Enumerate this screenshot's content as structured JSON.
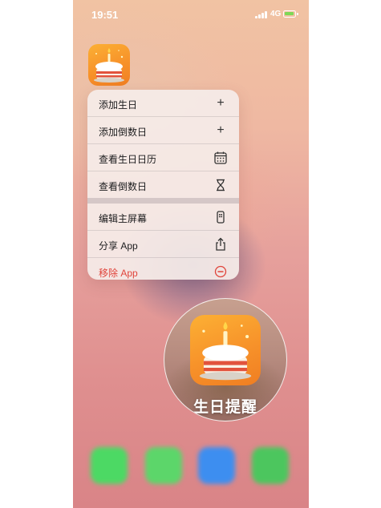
{
  "status_bar": {
    "time": "19:51",
    "network": "4G",
    "battery_charging": true,
    "colors": {
      "battery_fill": "#7ed957"
    }
  },
  "app": {
    "name": "生日提醒",
    "icon": "birthday-cake-icon",
    "colors": {
      "icon_top": "#fcb034",
      "icon_bottom": "#f07e22"
    }
  },
  "context_menu": {
    "items": [
      {
        "label": "添加生日",
        "icon": "plus-icon"
      },
      {
        "label": "添加倒数日",
        "icon": "plus-icon"
      },
      {
        "label": "查看生日日历",
        "icon": "calendar-icon"
      },
      {
        "label": "查看倒数日",
        "icon": "hourglass-icon"
      },
      {
        "label": "编辑主屏幕",
        "icon": "phone-screen-icon"
      },
      {
        "label": "分享 App",
        "icon": "share-icon"
      },
      {
        "label": "移除 App",
        "icon": "minus-circle-icon",
        "destructive": true,
        "color": "#e0443b"
      }
    ]
  },
  "dock": {
    "apps": [
      {
        "icon": "phone-icon",
        "color": "#4cd964"
      },
      {
        "icon": "messages-icon",
        "color": "#5cd66a"
      },
      {
        "icon": "safari-icon",
        "color": "#3d8ef0"
      },
      {
        "icon": "wechat-icon",
        "color": "#4cc65e"
      }
    ]
  }
}
